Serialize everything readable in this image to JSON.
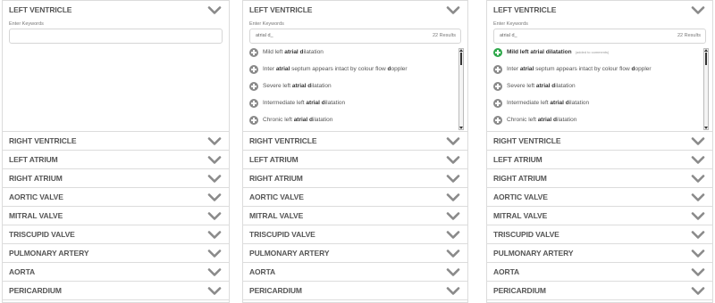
{
  "panels": [
    {
      "open_section": "LEFT VENTRICLE",
      "keywords_label": "Enter Keywords",
      "input_value": "",
      "results_count": "",
      "results": []
    },
    {
      "open_section": "LEFT VENTRICLE",
      "keywords_label": "Enter Keywords",
      "input_value": "atrial d_",
      "results_count": "22 Results",
      "results": [
        {
          "pre": "Mild left ",
          "bold": "atrial d",
          "post": "ilatation",
          "note": "",
          "added": false
        },
        {
          "pre": "Inter ",
          "bold": "atrial",
          "post": " septum appears intact by colour flow ",
          "bold2": "d",
          "post2": "oppler",
          "note": "",
          "added": false
        },
        {
          "pre": "Severe left ",
          "bold": "atrial d",
          "post": "ilatation",
          "note": "",
          "added": false
        },
        {
          "pre": "Intermediate left ",
          "bold": "atrial d",
          "post": "ilatation",
          "note": "",
          "added": false
        },
        {
          "pre": "Chronic left ",
          "bold": "atrial d",
          "post": "ilatation",
          "note": "",
          "added": false
        }
      ]
    },
    {
      "open_section": "LEFT VENTRICLE",
      "keywords_label": "Enter Keywords",
      "input_value": "atrial d_",
      "results_count": "22 Results",
      "results": [
        {
          "pre": "",
          "bold": "Mild left atrial dilatation",
          "post": "",
          "note": "(added to comments)",
          "added": true
        },
        {
          "pre": "Inter ",
          "bold": "atrial",
          "post": " septum appears intact by colour flow ",
          "bold2": "d",
          "post2": "oppler",
          "note": "",
          "added": false
        },
        {
          "pre": "Severe left ",
          "bold": "atrial d",
          "post": "ilatation",
          "note": "",
          "added": false
        },
        {
          "pre": "Intermediate left ",
          "bold": "atrial d",
          "post": "ilatation",
          "note": "",
          "added": false
        },
        {
          "pre": "Chronic left ",
          "bold": "atrial d",
          "post": "ilatation",
          "note": "",
          "added": false
        }
      ]
    }
  ],
  "sections": [
    "RIGHT VENTRICLE",
    "LEFT ATRIUM",
    "RIGHT ATRIUM",
    "AORTIC VALVE",
    "MITRAL VALVE",
    "TRISCUPID VALVE",
    "PULMONARY ARTERY",
    "AORTA",
    "PERICARDIUM"
  ],
  "icons": {
    "chevron": "chevron-down-icon",
    "add": "plus-circle-icon"
  },
  "colors": {
    "added_green": "#2ea84a",
    "add_grey": "#8a8a8a",
    "border": "#dcdcdc"
  }
}
